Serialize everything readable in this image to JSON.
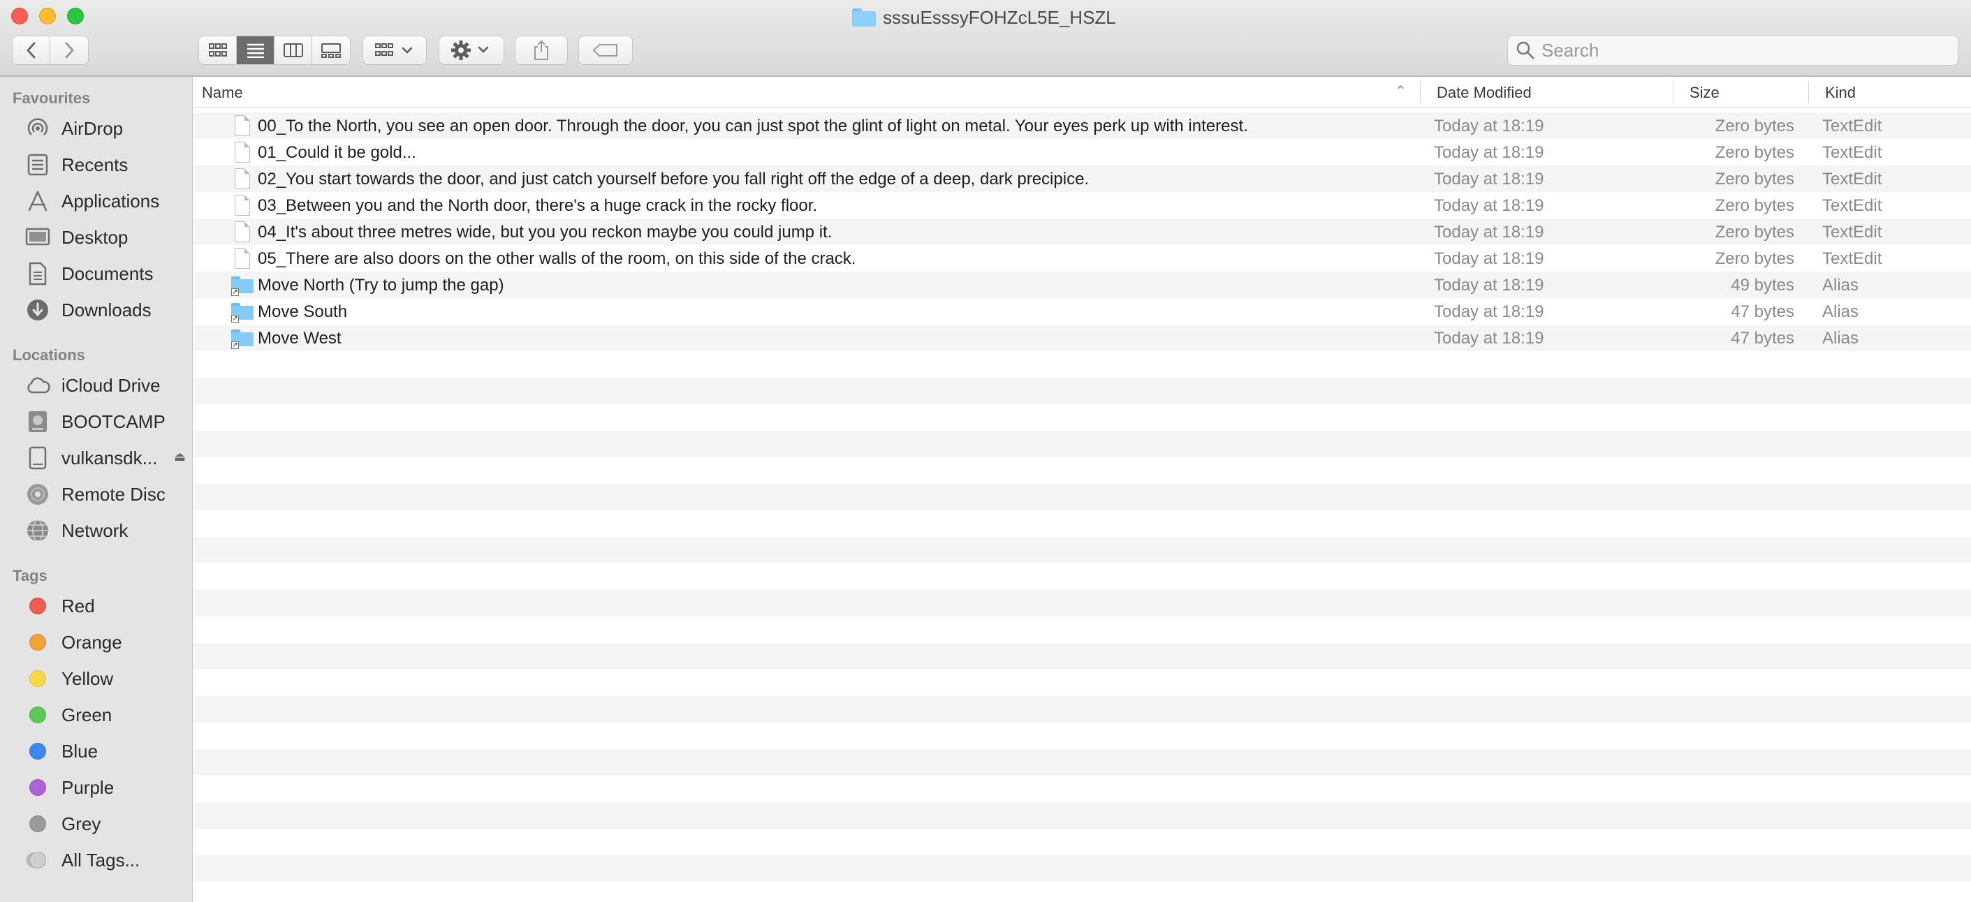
{
  "window": {
    "title": "sssuEsssyFOHZcL5E_HSZL"
  },
  "toolbar": {
    "back_icon": "chevron-left-icon",
    "forward_icon": "chevron-right-icon",
    "view_modes": [
      "icon-view",
      "list-view",
      "column-view",
      "gallery-view"
    ],
    "active_view": "list-view",
    "search_placeholder": "Search"
  },
  "sidebar": {
    "favourites_heading": "Favourites",
    "favourites": [
      {
        "label": "AirDrop",
        "icon": "airdrop-icon"
      },
      {
        "label": "Recents",
        "icon": "recents-icon"
      },
      {
        "label": "Applications",
        "icon": "applications-icon"
      },
      {
        "label": "Desktop",
        "icon": "desktop-icon"
      },
      {
        "label": "Documents",
        "icon": "documents-icon"
      },
      {
        "label": "Downloads",
        "icon": "downloads-icon"
      }
    ],
    "locations_heading": "Locations",
    "locations": [
      {
        "label": "iCloud Drive",
        "icon": "cloud-icon"
      },
      {
        "label": "BOOTCAMP",
        "icon": "disk-icon"
      },
      {
        "label": "vulkansdk...",
        "icon": "external-drive-icon"
      },
      {
        "label": "Remote Disc",
        "icon": "disc-icon"
      },
      {
        "label": "Network",
        "icon": "network-icon"
      }
    ],
    "tags_heading": "Tags",
    "tags": [
      {
        "label": "Red",
        "color": "#ee5b52"
      },
      {
        "label": "Orange",
        "color": "#f3a13a"
      },
      {
        "label": "Yellow",
        "color": "#f6d944"
      },
      {
        "label": "Green",
        "color": "#5dc85a"
      },
      {
        "label": "Blue",
        "color": "#3d87f0"
      },
      {
        "label": "Purple",
        "color": "#ad63d8"
      },
      {
        "label": "Grey",
        "color": "#9a9a9a"
      },
      {
        "label": "All Tags...",
        "color": "#cfcfcf"
      }
    ]
  },
  "columns": {
    "name": "Name",
    "date": "Date Modified",
    "size": "Size",
    "kind": "Kind"
  },
  "files": [
    {
      "name": "00_To the North, you see an open door. Through the door, you can just spot the glint of light on metal. Your eyes perk up with interest.",
      "date": "Today at 18:19",
      "size": "Zero bytes",
      "kind": "TextEdit",
      "type": "doc"
    },
    {
      "name": "01_Could it be gold...",
      "date": "Today at 18:19",
      "size": "Zero bytes",
      "kind": "TextEdit",
      "type": "doc"
    },
    {
      "name": "02_You start towards the door, and just catch yourself before you fall right off the edge of a deep, dark precipice.",
      "date": "Today at 18:19",
      "size": "Zero bytes",
      "kind": "TextEdit",
      "type": "doc"
    },
    {
      "name": "03_Between you and the North door, there's a huge crack in the rocky floor.",
      "date": "Today at 18:19",
      "size": "Zero bytes",
      "kind": "TextEdit",
      "type": "doc"
    },
    {
      "name": "04_It's about three metres wide, but you you reckon maybe you could jump it.",
      "date": "Today at 18:19",
      "size": "Zero bytes",
      "kind": "TextEdit",
      "type": "doc"
    },
    {
      "name": "05_There are also doors on the other walls of the room, on this side of the crack.",
      "date": "Today at 18:19",
      "size": "Zero bytes",
      "kind": "TextEdit",
      "type": "doc"
    },
    {
      "name": "Move North (Try to jump the gap)",
      "date": "Today at 18:19",
      "size": "49 bytes",
      "kind": "Alias",
      "type": "alias"
    },
    {
      "name": "Move South",
      "date": "Today at 18:19",
      "size": "47 bytes",
      "kind": "Alias",
      "type": "alias"
    },
    {
      "name": "Move West",
      "date": "Today at 18:19",
      "size": "47 bytes",
      "kind": "Alias",
      "type": "alias"
    }
  ]
}
